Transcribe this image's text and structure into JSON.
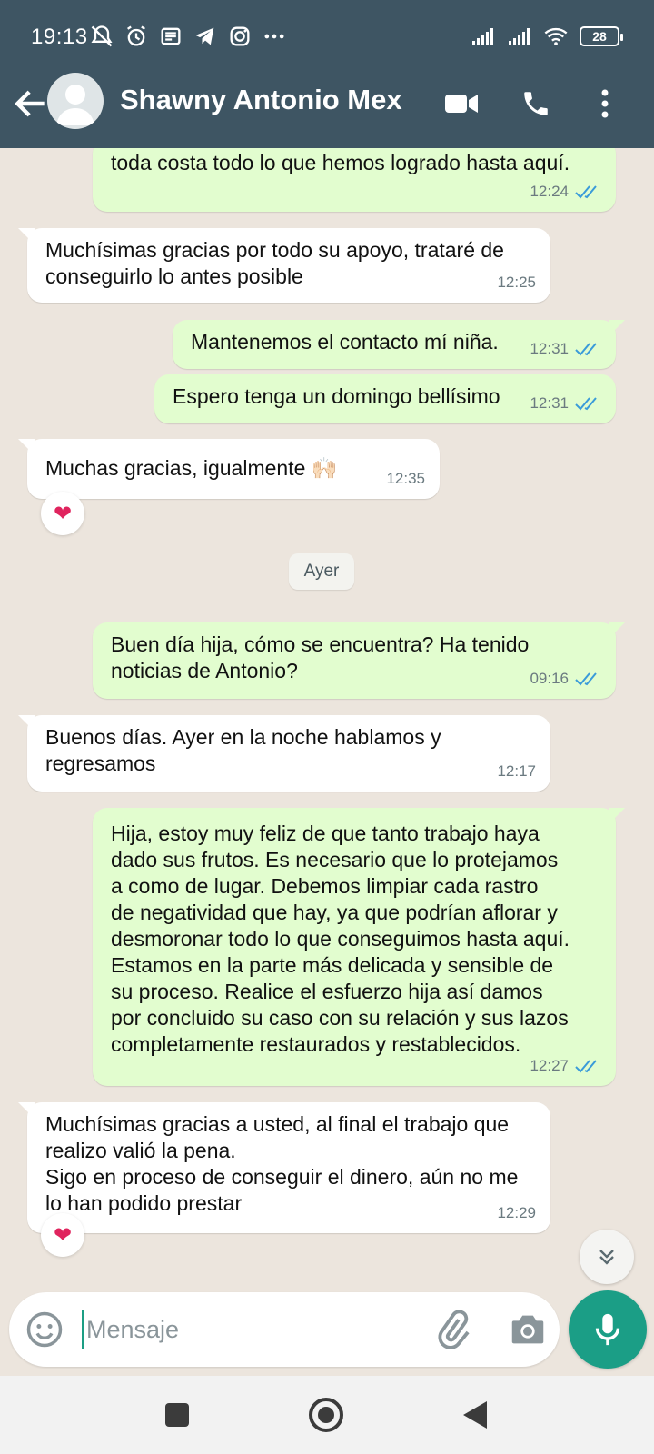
{
  "status_bar": {
    "time": "19:13",
    "battery": "28",
    "left_icons": [
      "mute-alarm-icon",
      "alarm-icon",
      "notes-icon",
      "telegram-icon",
      "instagram-icon",
      "more-dots-icon"
    ],
    "right_icons": [
      "signal-icon",
      "signal-icon",
      "wifi-icon",
      "battery-icon"
    ]
  },
  "header": {
    "contact_name": "Shawny Antonio Mex",
    "icons": [
      "back-arrow-icon",
      "avatar-icon",
      "video-call-icon",
      "phone-icon",
      "more-vert-icon"
    ]
  },
  "colors": {
    "header": "#3e5563",
    "outgoing_bubble": "#e2fdcf",
    "incoming_bubble": "#ffffff",
    "read_ticks": "#3a9bd9",
    "accent": "#1b9e86",
    "chat_bg": "#ece5dd"
  },
  "messages": [
    {
      "dir": "out",
      "text": "toda costa todo lo que hemos logrado hasta aquí.",
      "time": "12:24",
      "status": "read"
    },
    {
      "dir": "in",
      "text": "Muchísimas gracias por todo su apoyo, trataré de\nconseguirlo lo antes posible",
      "time": "12:25"
    },
    {
      "dir": "out",
      "text": "Mantenemos el contacto mí niña.",
      "time": "12:31",
      "status": "read"
    },
    {
      "dir": "out",
      "text": "Espero tenga un domingo bellísimo",
      "time": "12:31",
      "status": "read"
    },
    {
      "dir": "in",
      "text": "Muchas gracias, igualmente 🙌🏻",
      "time": "12:35",
      "reaction": "❤"
    },
    {
      "dir": "out",
      "text": "Buen día hija, cómo se encuentra? Ha tenido\nnoticias de Antonio?",
      "time": "09:16",
      "status": "read"
    },
    {
      "dir": "in",
      "text": "Buenos días. Ayer en la noche hablamos y\nregresamos",
      "time": "12:17"
    },
    {
      "dir": "out",
      "text": "Hija, estoy muy feliz de que tanto trabajo haya\ndado sus frutos. Es necesario que lo protejamos\na como de lugar. Debemos limpiar cada rastro\nde negatividad que hay, ya que podrían aflorar y\ndesmoronar todo lo que conseguimos hasta aquí.\nEstamos en la parte más delicada y sensible de\nsu proceso. Realice el esfuerzo hija así damos\npor concluido su caso con su relación y sus lazos\ncompletamente restaurados y restablecidos.",
      "time": "12:27",
      "status": "read"
    },
    {
      "dir": "in",
      "text": "Muchísimas gracias a usted, al final el trabajo que\nrealizo valió la pena.\nSigo en proceso de conseguir el dinero, aún no me\nlo han podido prestar",
      "time": "12:29",
      "reaction": "❤"
    }
  ],
  "date_separator": "Ayer",
  "composer": {
    "placeholder": "Mensaje",
    "value": ""
  },
  "nav_bar": {
    "icons": [
      "recents-square-icon",
      "home-circle-icon",
      "back-triangle-icon"
    ]
  }
}
